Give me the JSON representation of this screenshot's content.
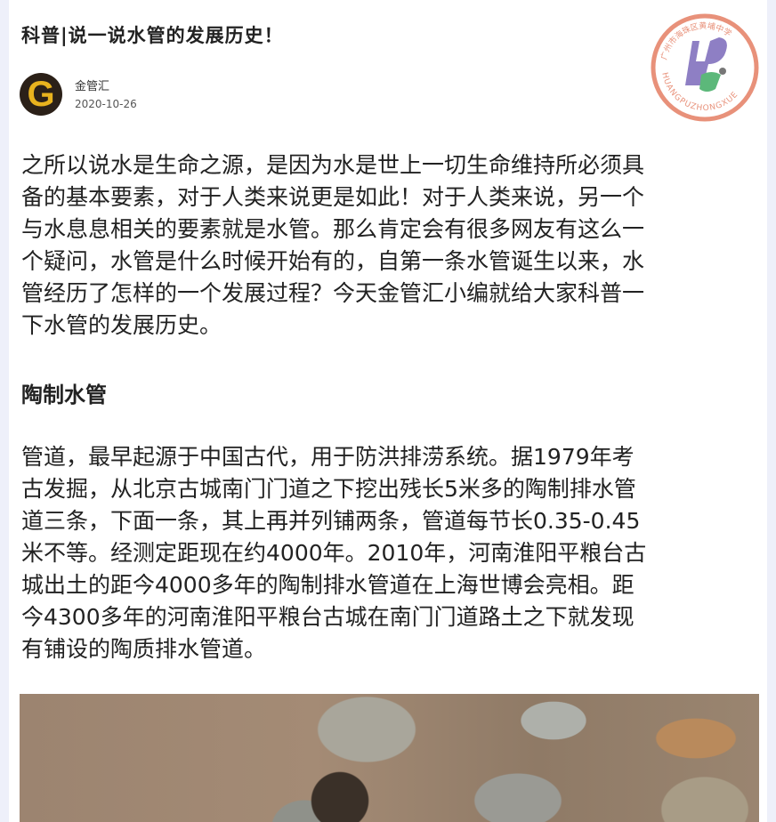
{
  "article": {
    "title": "科普|说一说水管的发展历史！",
    "author": "金管汇",
    "date": "2020-10-26",
    "avatar_letter": "G",
    "paragraph1": [
      "之所以说水是生命之源，是因为水是世上一切生命维持所必须具",
      "备的基本要素，对于人类来说更是如此！对于人类来说，另一个",
      "与水息息相关的要素就是水管。那么肯定会有很多网友有这么一",
      "个疑问，水管是什么时候开始有的，自第一条水管诞生以来，水",
      "管经历了怎样的一个发展过程？今天金管汇小编就给大家科普一",
      "下水管的发展历史。"
    ],
    "heading": "陶制水管",
    "paragraph2": [
      "管道，最早起源于中国古代，用于防洪排涝系统。据1979年考",
      "古发掘，从北京古城南门门道之下挖出残长5米多的陶制排水管",
      "道三条，下面一条，其上再并列铺两条，管道每节长0.35-0.45",
      "米不等。经测定距现在约4000年。2010年，河南淮阳平粮台古",
      "城出土的距今4000多年的陶制排水管道在上海世博会亮相。距",
      "今4300多年的河南淮阳平粮台古城在南门门道路土之下就发现",
      "有铺设的陶质排水管道。"
    ]
  },
  "watermark": {
    "text_cn": "广州市海珠区黄埔中学",
    "text_en": "HUANGPUZHONGXUE",
    "ring_color": "#e8917a",
    "mark_color": "#8e7fc4"
  },
  "colors": {
    "text": "#222222",
    "avatar_bg": "#2b2018",
    "avatar_letter": "#e8b21e"
  }
}
